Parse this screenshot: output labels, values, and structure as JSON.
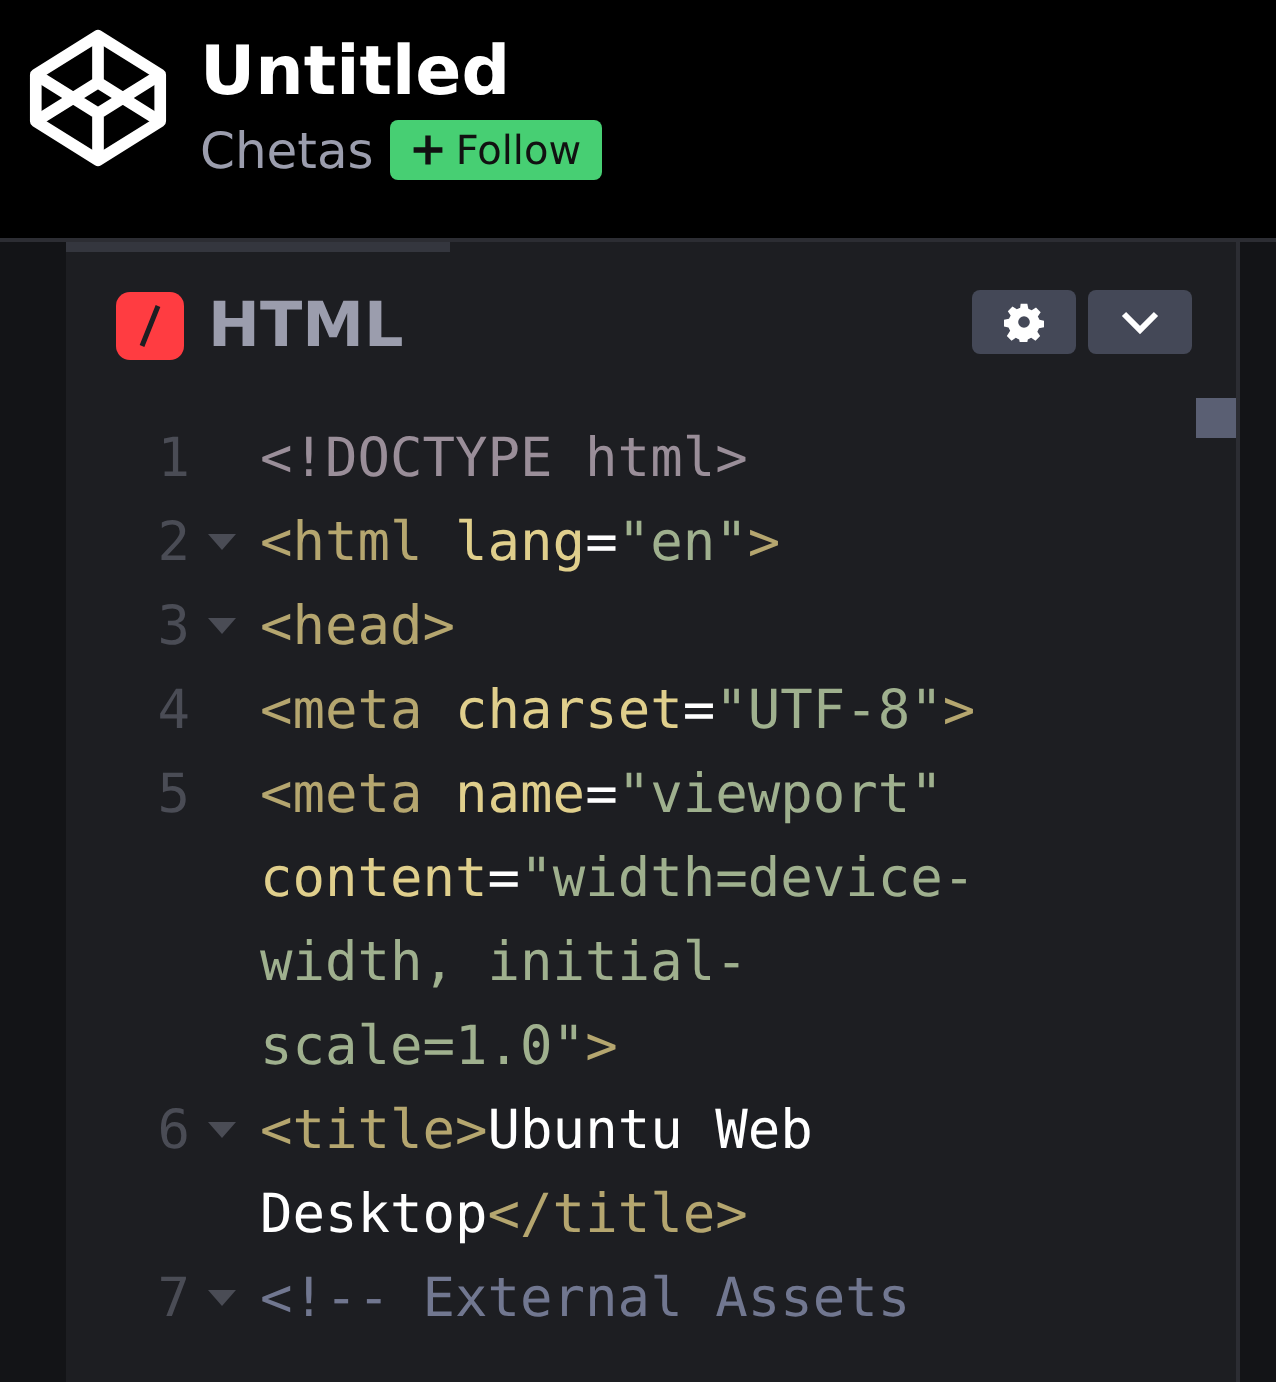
{
  "header": {
    "title": "Untitled",
    "author": "Chetas",
    "follow_button": "Follow"
  },
  "editor": {
    "tab": {
      "label": "HTML",
      "selected": true
    },
    "lines": [
      {
        "number": "1",
        "foldable": false,
        "tokens": [
          {
            "kind": "doctype",
            "text": "<!DOCTYPE html>"
          }
        ]
      },
      {
        "number": "2",
        "foldable": true,
        "tokens": [
          {
            "kind": "tag",
            "text": "<html"
          },
          {
            "kind": "attr",
            "text": " lang"
          },
          {
            "kind": "eq",
            "text": "="
          },
          {
            "kind": "string",
            "text": "\"en\""
          },
          {
            "kind": "tag",
            "text": ">"
          }
        ]
      },
      {
        "number": "3",
        "foldable": true,
        "tokens": [
          {
            "kind": "tag",
            "text": "<head>"
          }
        ]
      },
      {
        "number": "4",
        "foldable": false,
        "tokens": [
          {
            "kind": "tag",
            "text": "<meta"
          },
          {
            "kind": "attr",
            "text": " charset"
          },
          {
            "kind": "eq",
            "text": "="
          },
          {
            "kind": "string",
            "text": "\"UTF-8\""
          },
          {
            "kind": "tag",
            "text": ">"
          }
        ]
      },
      {
        "number": "5",
        "foldable": false,
        "tokens": [
          {
            "kind": "tag",
            "text": "<meta"
          },
          {
            "kind": "attr",
            "text": " name"
          },
          {
            "kind": "eq",
            "text": "="
          },
          {
            "kind": "string",
            "text": "\"viewport\""
          }
        ]
      },
      {
        "foldable": false,
        "tokens": [
          {
            "kind": "attr",
            "text": "content"
          },
          {
            "kind": "eq",
            "text": "="
          },
          {
            "kind": "string",
            "text": "\"width=device-"
          }
        ]
      },
      {
        "foldable": false,
        "tokens": [
          {
            "kind": "string",
            "text": "width, initial-"
          }
        ]
      },
      {
        "foldable": false,
        "tokens": [
          {
            "kind": "string",
            "text": "scale=1.0\""
          },
          {
            "kind": "tag",
            "text": ">"
          }
        ]
      },
      {
        "number": "6",
        "foldable": true,
        "tokens": [
          {
            "kind": "tag",
            "text": "<title>"
          },
          {
            "kind": "text",
            "text": "Ubuntu Web"
          }
        ]
      },
      {
        "foldable": false,
        "tokens": [
          {
            "kind": "text",
            "text": "Desktop"
          },
          {
            "kind": "tag",
            "text": "</title>"
          }
        ]
      },
      {
        "number": "7",
        "foldable": true,
        "tokens": [
          {
            "kind": "comment",
            "text": "<!-- External Assets"
          }
        ]
      }
    ]
  }
}
